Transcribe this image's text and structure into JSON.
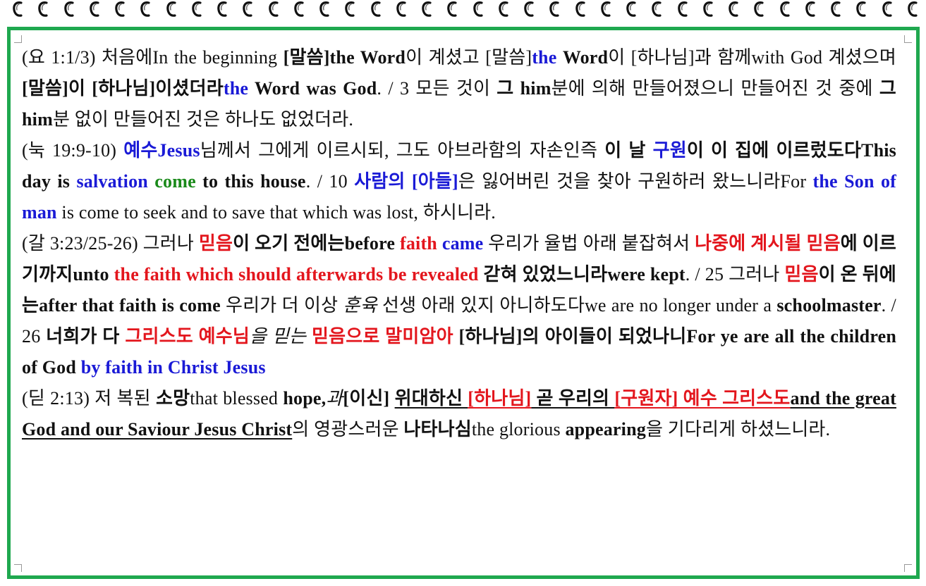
{
  "p1": {
    "s01": "(요 1:1/3) 처음에In the beginning ",
    "s02": "[말씀]the Word",
    "s03": "이 계셨고 [말씀]",
    "s04": "the",
    "s05": " ",
    "s06": "Word",
    "s07": "이 [하나님]과 함께with God 계셨으며 ",
    "s08": "[말씀]이 [하나님]이셨더라",
    "s09": "the",
    "s10": " Word was God",
    "s11": ". / 3 모든 것이 ",
    "s12": "그 him",
    "s13": "분에 의해 만들어졌으니 만들어진 것 중에 ",
    "s14": "그him",
    "s15": "분 없이 만들어진 것은 하나도 없었더라."
  },
  "p2": {
    "s01": "(눅 19:9-10) ",
    "s02": "예수Jesus",
    "s03": "님께서 그에게 이르시되, 그도 아브라함의 자손인즉 ",
    "s04": "이 날 ",
    "s05": "구원",
    "s06": "이 이 집에 이르렀도다This day is ",
    "s07": "salvation",
    "s08": " ",
    "s09": "come",
    "s10": " to this house",
    "s11": ". / 10 ",
    "s12": "사람의 [아들]",
    "s13": "은 잃어버린 것을 찾아 구원하러 왔느니라For ",
    "s14": "the Son of man",
    "s15": " is come to seek and to save that which was lost, 하시니라."
  },
  "p3": {
    "s01": "(갈 3:23/25-26) 그러나 ",
    "s02": "믿음",
    "s03": "이 오기 전에는before ",
    "s04": "faith",
    "s05": " ",
    "s06": "came",
    "s07": " 우리가 율법 아래 붙잡혀서 ",
    "s08": "나중에 계시될 믿음",
    "s09": "에 이르기까지unto ",
    "s10": "the faith which should afterwards be revealed",
    "s11": " 갇혀 있었느니라were kept",
    "s12": ". / 25 그러나 ",
    "s13": "믿음",
    "s14": "이 온 뒤에는after that faith is come",
    "s15": " 우리가 더 이상 ",
    "s16": "훈육",
    "s17": " 선생 아래 있지 아니하도다we are no longer under a ",
    "s18": "schoolmaster",
    "s19": ". / 26 ",
    "s20": "너희가 다 ",
    "s21": "그리스도 예수님",
    "s22": "을 믿는",
    "s23": " 믿음으로 말미암아",
    "s24": " [하나님]의 아이들이 되었나니For ye are all the children of God ",
    "s25": "by faith in Christ Jesus"
  },
  "p4": {
    "s01": "(딛 2:13) 저 복된 ",
    "s02": "소망",
    "s03": "that blessed ",
    "s04": "hope,",
    "s05": "과",
    "s06": "[이신]",
    "s07": " ",
    "s08": "위대하신 ",
    "s09": "[하나님]",
    "s10": " 곧 우리의 ",
    "s11": "[구원자] 예수 그리스도",
    "s12": "and the great God and our Saviour Jesus Christ",
    "s13": "의 영광스러운 ",
    "s14": "나타나심",
    "s15": "the glorious ",
    "s16": "appearing",
    "s17": "을 기다리게 하셨느니라."
  },
  "colors": {
    "frame": "#1fa84f",
    "blue": "#1a1ad6",
    "red": "#e3161d",
    "green": "#1a8a1a"
  }
}
